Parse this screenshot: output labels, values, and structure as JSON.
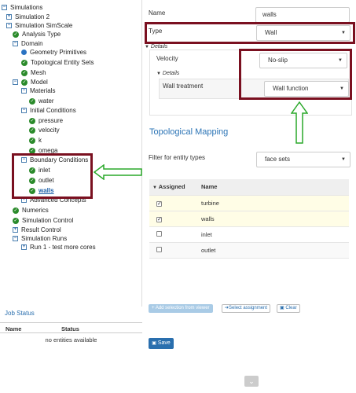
{
  "tree": {
    "root": "Simulations",
    "simulation2": "Simulation 2",
    "simscale": "Simulation SimScale",
    "analysis_type": "Analysis Type",
    "domain": "Domain",
    "geometry_primitives": "Geometry Primitives",
    "topological_entity_sets": "Topological Entity Sets",
    "mesh": "Mesh",
    "model": "Model",
    "materials": "Materials",
    "water": "water",
    "initial_conditions": "Initial Conditions",
    "pressure": "pressure",
    "velocity": "velocity",
    "k": "k",
    "omega": "omega",
    "boundary_conditions": "Boundary Conditions",
    "inlet": "inlet",
    "outlet": "outlet",
    "walls": "walls",
    "advanced_concepts": "Advanced Concepts",
    "numerics": "Numerics",
    "simulation_control": "Simulation Control",
    "result_control": "Result Control",
    "simulation_runs": "Simulation Runs",
    "run1": "Run 1 - test more cores"
  },
  "job_status": {
    "title": "Job Status",
    "col_name": "Name",
    "col_status": "Status",
    "empty": "no entities available"
  },
  "form": {
    "name_label": "Name",
    "name_value": "walls",
    "type_label": "Type",
    "type_value": "Wall",
    "details_label": "Details",
    "velocity_label": "Velocity",
    "velocity_value": "No-slip",
    "details2_label": "Details",
    "wall_treatment_label": "Wall treatment",
    "wall_treatment_value": "Wall function"
  },
  "topo": {
    "title": "Topological Mapping",
    "filter_label": "Filter for entity types",
    "filter_value": "face sets",
    "col_assigned": "Assigned",
    "col_name": "Name",
    "rows": [
      {
        "name": "turbine",
        "checked": true
      },
      {
        "name": "walls",
        "checked": true
      },
      {
        "name": "inlet",
        "checked": false
      },
      {
        "name": "outlet",
        "checked": false
      }
    ]
  },
  "buttons": {
    "add_selection": "+ Add selection from viewer",
    "select_assignment": "Select assignment",
    "clear": "Clear",
    "save": "Save"
  },
  "colors": {
    "accent": "#2a6fae",
    "annotation_box": "#7a1020",
    "annotation_arrow": "#2aa82a",
    "check": "#2a8a2a"
  }
}
